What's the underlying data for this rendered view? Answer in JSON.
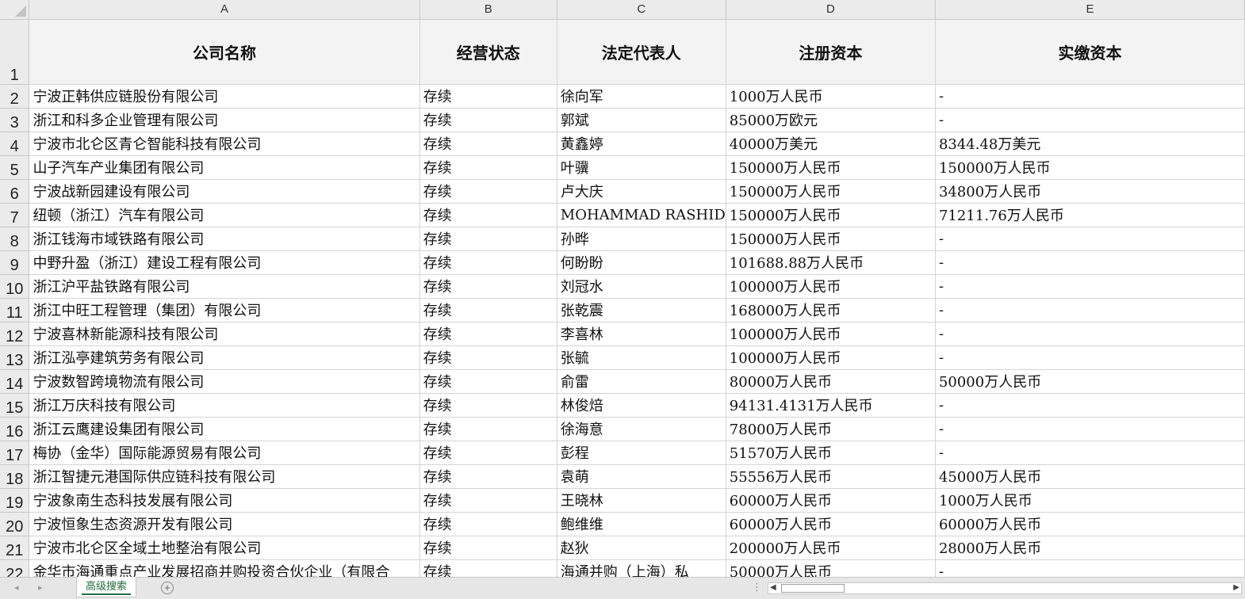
{
  "columns": [
    "A",
    "B",
    "C",
    "D",
    "E"
  ],
  "header_row": {
    "number": "1",
    "cells": [
      "公司名称",
      "经营状态",
      "法定代表人",
      "注册资本",
      "实缴资本"
    ]
  },
  "rows": [
    {
      "number": "2",
      "cells": [
        "宁波正韩供应链股份有限公司",
        "存续",
        "徐向军",
        "1000万人民币",
        "-"
      ]
    },
    {
      "number": "3",
      "cells": [
        "浙江和科多企业管理有限公司",
        "存续",
        "郭斌",
        "85000万欧元",
        "-"
      ]
    },
    {
      "number": "4",
      "cells": [
        "宁波市北仑区青仑智能科技有限公司",
        "存续",
        "黄鑫婷",
        "40000万美元",
        "8344.48万美元"
      ]
    },
    {
      "number": "5",
      "cells": [
        "山子汽车产业集团有限公司",
        "存续",
        "叶骥",
        "150000万人民币",
        "150000万人民币"
      ]
    },
    {
      "number": "6",
      "cells": [
        "宁波战新园建设有限公司",
        "存续",
        "卢大庆",
        "150000万人民币",
        "34800万人民币"
      ]
    },
    {
      "number": "7",
      "cells": [
        "纽顿（浙江）汽车有限公司",
        "存续",
        "MOHAMMAD RASHID",
        "150000万人民币",
        "71211.76万人民币"
      ]
    },
    {
      "number": "8",
      "cells": [
        "浙江钱海市域铁路有限公司",
        "存续",
        "孙晔",
        "150000万人民币",
        "-"
      ]
    },
    {
      "number": "9",
      "cells": [
        "中野升盈（浙江）建设工程有限公司",
        "存续",
        "何盼盼",
        "101688.88万人民币",
        "-"
      ]
    },
    {
      "number": "10",
      "cells": [
        "浙江沪平盐铁路有限公司",
        "存续",
        "刘冠水",
        "100000万人民币",
        "-"
      ]
    },
    {
      "number": "11",
      "cells": [
        "浙江中旺工程管理（集团）有限公司",
        "存续",
        "张乾震",
        "168000万人民币",
        "-"
      ]
    },
    {
      "number": "12",
      "cells": [
        "宁波喜林新能源科技有限公司",
        "存续",
        "李喜林",
        "100000万人民币",
        "-"
      ]
    },
    {
      "number": "13",
      "cells": [
        "浙江泓亭建筑劳务有限公司",
        "存续",
        "张毓",
        "100000万人民币",
        "-"
      ]
    },
    {
      "number": "14",
      "cells": [
        "宁波数智跨境物流有限公司",
        "存续",
        "俞雷",
        "80000万人民币",
        "50000万人民币"
      ]
    },
    {
      "number": "15",
      "cells": [
        "浙江万庆科技有限公司",
        "存续",
        "林俊焙",
        "94131.4131万人民币",
        "-"
      ]
    },
    {
      "number": "16",
      "cells": [
        "浙江云鹰建设集团有限公司",
        "存续",
        "徐海意",
        "78000万人民币",
        "-"
      ]
    },
    {
      "number": "17",
      "cells": [
        "梅协（金华）国际能源贸易有限公司",
        "存续",
        "彭程",
        "51570万人民币",
        "-"
      ]
    },
    {
      "number": "18",
      "cells": [
        "浙江智捷元港国际供应链科技有限公司",
        "存续",
        "袁萌",
        "55556万人民币",
        "45000万人民币"
      ]
    },
    {
      "number": "19",
      "cells": [
        "宁波象南生态科技发展有限公司",
        "存续",
        "王晓林",
        "60000万人民币",
        "1000万人民币"
      ]
    },
    {
      "number": "20",
      "cells": [
        "宁波恒象生态资源开发有限公司",
        "存续",
        "鲍维维",
        "60000万人民币",
        "60000万人民币"
      ]
    },
    {
      "number": "21",
      "cells": [
        "宁波市北仑区全域土地整治有限公司",
        "存续",
        "赵狄",
        "200000万人民币",
        "28000万人民币"
      ]
    },
    {
      "number": "22",
      "cells": [
        "金华市海通重点产业发展招商并购投资合伙企业（有限合",
        "存续",
        "海通并购（上海）私",
        "50000万人民币",
        "-"
      ]
    }
  ],
  "sheet_tabs": [
    "高级搜索"
  ],
  "icons": {
    "add_sheet": "plus-circle-icon",
    "prev": "chevron-left-icon",
    "next": "chevron-right-icon",
    "scroll_left": "triangle-left-icon",
    "scroll_right": "triangle-right-icon"
  },
  "glyphs": {
    "add": "+",
    "prev": "◂",
    "next": "▸",
    "scroll_left": "◀",
    "scroll_right": "▶",
    "dots": "⋮"
  },
  "colors": {
    "tab_accent": "#217346",
    "header_bg": "#ebebeb"
  }
}
